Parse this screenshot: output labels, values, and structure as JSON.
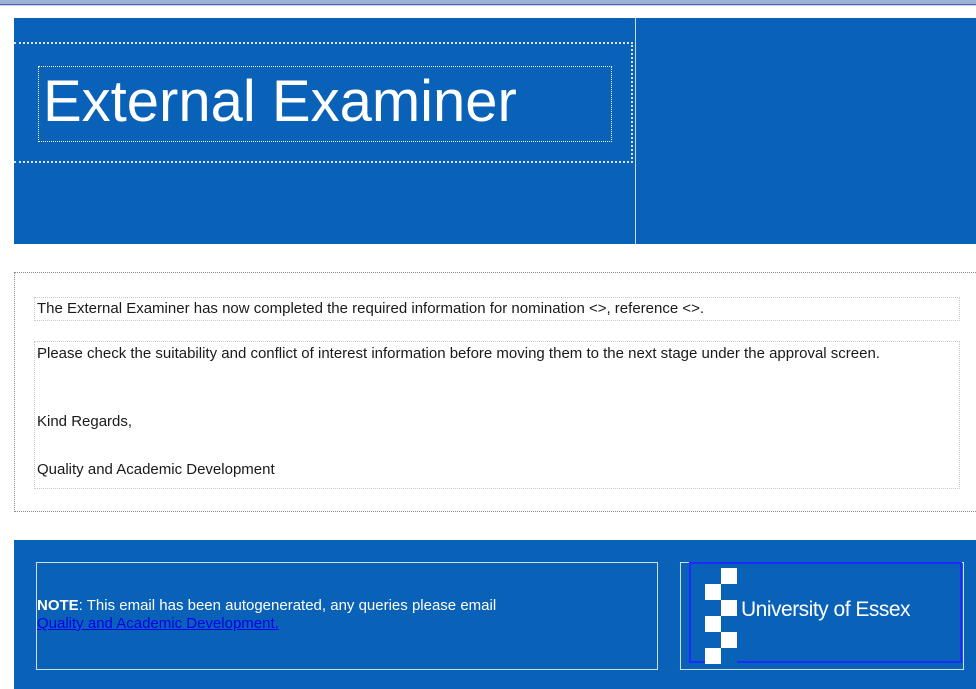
{
  "header": {
    "title": "External Examiner"
  },
  "message": {
    "line1": "The External Examiner has now completed the required information for nomination <>, reference <>.",
    "line2": "Please check the suitability and conflict of interest information before moving them to the next stage under the approval screen.",
    "closing": "Kind Regards,",
    "signature": "Quality and Academic Development"
  },
  "footer": {
    "note_label": "NOTE",
    "note_text": ": This email has been autogenerated, any queries please email",
    "note_link": "Quality and Academic Development.",
    "logo_text": "University of Essex",
    "logo_icon": "essex-checker-logo-icon"
  },
  "colors": {
    "brand_blue": "#0a62b8",
    "link_blue": "#0000ee"
  }
}
